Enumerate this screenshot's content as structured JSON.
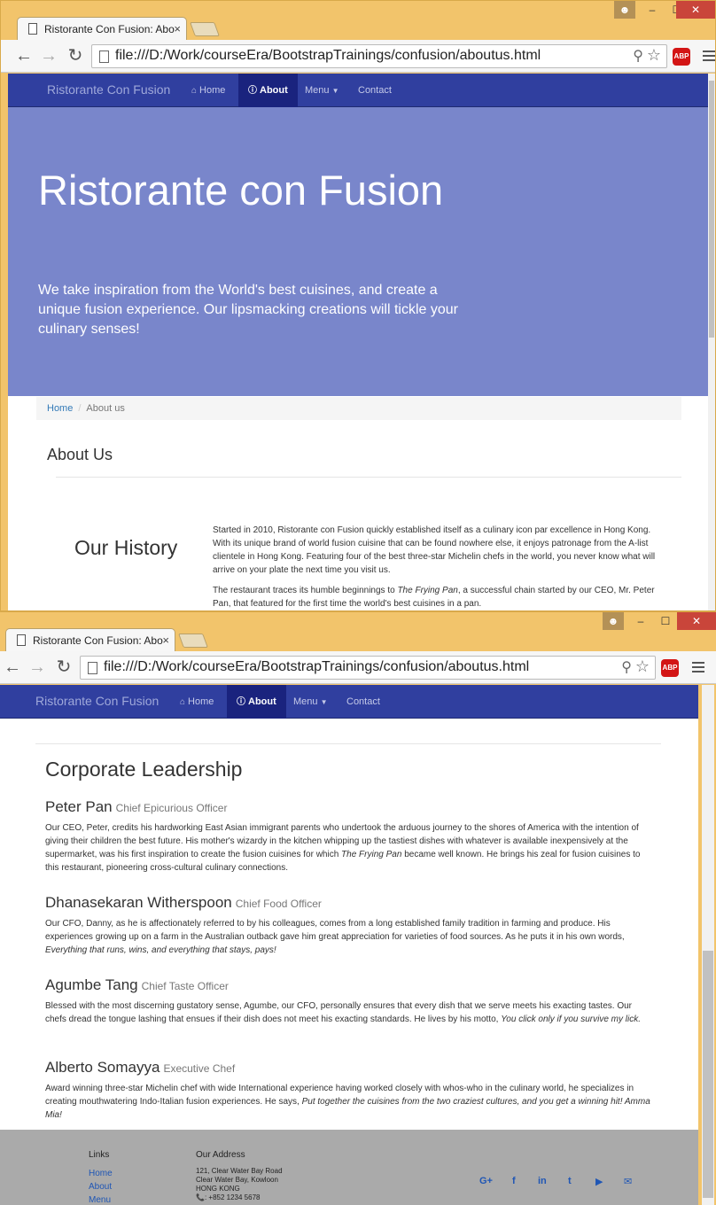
{
  "browser": {
    "tab_title": "Ristorante Con Fusion: Abo",
    "tab_close": "×",
    "url": "file:///D:/Work/courseEra/BootstrapTrainings/confusion/aboutus.html",
    "abp": "ABP",
    "win_min": "–",
    "win_max": "☐",
    "win_close": "✕"
  },
  "nav": {
    "brand": "Ristorante Con Fusion",
    "home": "Home",
    "about": "About",
    "menu": "Menu",
    "contact": "Contact"
  },
  "jumbotron": {
    "title": "Ristorante con Fusion",
    "tagline": "We take inspiration from the World's best cuisines, and create a unique fusion experience. Our lipsmacking creations will tickle your culinary senses!"
  },
  "breadcrumb": {
    "home": "Home",
    "current": "About us"
  },
  "about": {
    "heading": "About Us",
    "history_title": "Our History",
    "history_p1": "Started in 2010, Ristorante con Fusion quickly established itself as a culinary icon par excellence in Hong Kong. With its unique brand of world fusion cuisine that can be found nowhere else, it enjoys patronage from the A-list clientele in Hong Kong. Featuring four of the best three-star Michelin chefs in the world, you never know what will arrive on your plate the next time you visit us.",
    "history_p2_pre": "The restaurant traces its humble beginnings to ",
    "history_p2_em": "The Frying Pan",
    "history_p2_post": ", a successful chain started by our CEO, Mr. Peter Pan, that featured for the first time the world's best cuisines in a pan."
  },
  "leadership": {
    "title": "Corporate Leadership",
    "leaders": [
      {
        "name": "Peter Pan",
        "role": "Chief Epicurious Officer",
        "bio_pre": "Our CEO, Peter, credits his hardworking East Asian immigrant parents who undertook the arduous journey to the shores of America with the intention of giving their children the best future. His mother's wizardy in the kitchen whipping up the tastiest dishes with whatever is available inexpensively at the supermarket, was his first inspiration to create the fusion cuisines for which ",
        "bio_em": "The Frying Pan",
        "bio_post": " became well known. He brings his zeal for fusion cuisines to this restaurant, pioneering cross-cultural culinary connections."
      },
      {
        "name": "Dhanasekaran Witherspoon",
        "role": "Chief Food Officer",
        "bio_pre": "Our CFO, Danny, as he is affectionately referred to by his colleagues, comes from a long established family tradition in farming and produce. His experiences growing up on a farm in the Australian outback gave him great appreciation for varieties of food sources. As he puts it in his own words, ",
        "bio_em": "Everything that runs, wins, and everything that stays, pays!",
        "bio_post": ""
      },
      {
        "name": "Agumbe Tang",
        "role": "Chief Taste Officer",
        "bio_pre": "Blessed with the most discerning gustatory sense, Agumbe, our CFO, personally ensures that every dish that we serve meets his exacting tastes. Our chefs dread the tongue lashing that ensues if their dish does not meet his exacting standards. He lives by his motto, ",
        "bio_em": "You click only if you survive my lick.",
        "bio_post": ""
      },
      {
        "name": "Alberto Somayya",
        "role": "Executive Chef",
        "bio_pre": "Award winning three-star Michelin chef with wide International experience having worked closely with whos-who in the culinary world, he specializes in creating mouthwatering Indo-Italian fusion experiences. He says, ",
        "bio_em": "Put together the cuisines from the two craziest cultures, and you get a winning hit! Amma Mia!",
        "bio_post": ""
      }
    ]
  },
  "footer": {
    "links_heading": "Links",
    "links": [
      "Home",
      "About",
      "Menu"
    ],
    "address_heading": "Our Address",
    "address": [
      "121, Clear Water Bay Road",
      "Clear Water Bay, Kowloon",
      "HONG KONG",
      "📞: +852 1234 5678"
    ],
    "social": [
      "G+",
      "f",
      "in",
      "t",
      "▶",
      "✉"
    ]
  },
  "colors": {
    "navbar": "#303f9f",
    "navbar_active": "#1a237e",
    "jumbotron": "#7986cb",
    "footer": "#aaaaaa",
    "chrome_frame": "#f2c46b"
  }
}
